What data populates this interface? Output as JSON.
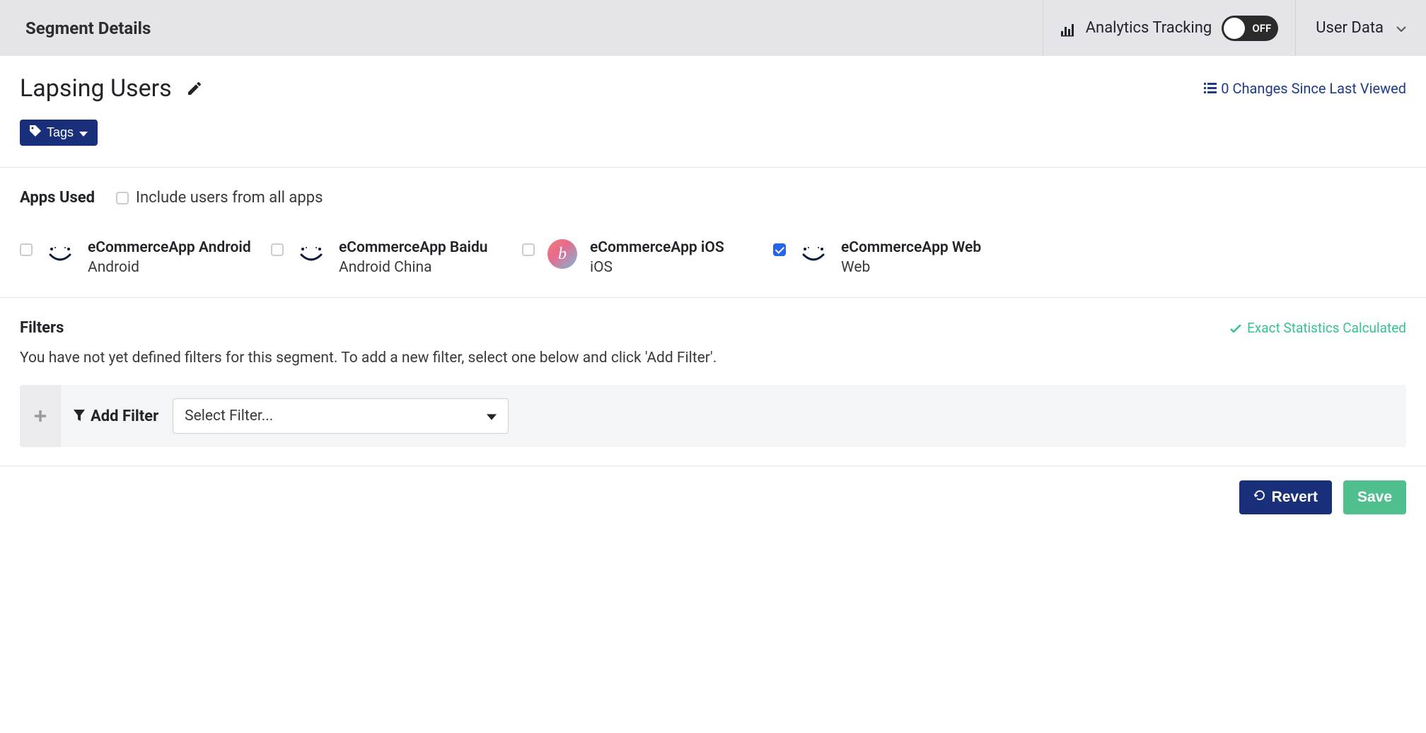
{
  "header": {
    "title": "Segment Details",
    "analytics_label": "Analytics Tracking",
    "toggle_state": "OFF",
    "user_data_label": "User Data"
  },
  "segment": {
    "name": "Lapsing Users",
    "changes_link": "0 Changes Since Last Viewed",
    "tags_button": "Tags"
  },
  "apps_used": {
    "heading": "Apps Used",
    "include_all_label": "Include users from all apps",
    "apps": [
      {
        "name": "eCommerceApp Android",
        "platform": "Android",
        "checked": false,
        "logo": "smile"
      },
      {
        "name": "eCommerceApp Baidu",
        "platform": "Android China",
        "checked": false,
        "logo": "smile"
      },
      {
        "name": "eCommerceApp iOS",
        "platform": "iOS",
        "checked": false,
        "logo": "gradient"
      },
      {
        "name": "eCommerceApp Web",
        "platform": "Web",
        "checked": true,
        "logo": "smile"
      }
    ]
  },
  "filters": {
    "heading": "Filters",
    "status": "Exact Statistics Calculated",
    "helptext": "You have not yet defined filters for this segment. To add a new filter, select one below and click 'Add Filter'.",
    "add_filter_label": "Add Filter",
    "select_placeholder": "Select Filter..."
  },
  "footer": {
    "revert_label": "Revert",
    "save_label": "Save"
  }
}
